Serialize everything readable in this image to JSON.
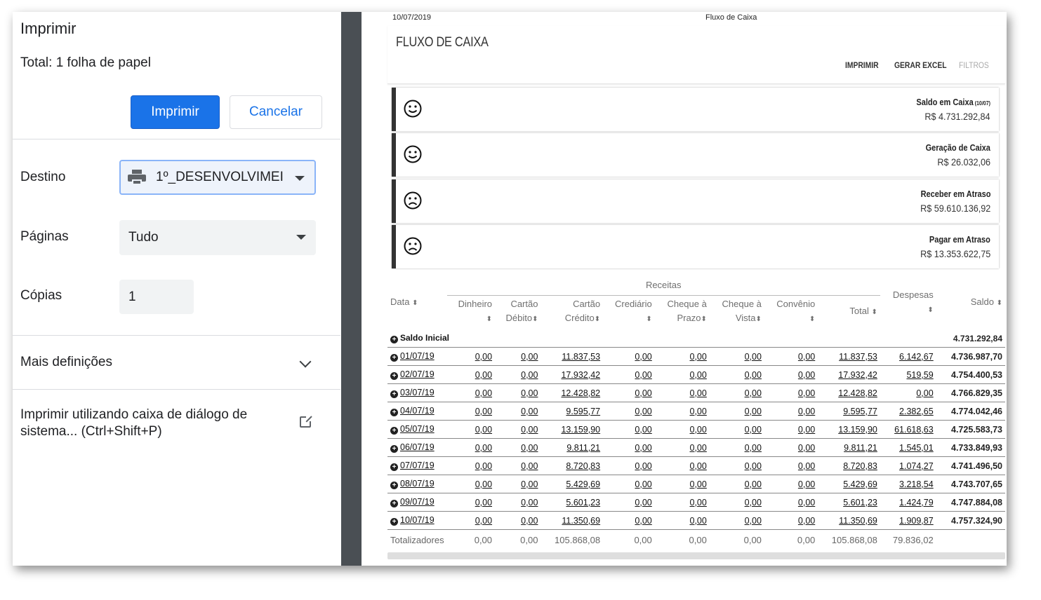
{
  "print_dialog": {
    "title": "Imprimir",
    "total": "Total: 1 folha de papel",
    "print_button": "Imprimir",
    "cancel_button": "Cancelar",
    "destination_label": "Destino",
    "destination_value": "1º_DESENVOLVIMEI",
    "pages_label": "Páginas",
    "pages_value": "Tudo",
    "copies_label": "Cópias",
    "copies_value": "1",
    "more_settings": "Mais definições",
    "system_dialog": "Imprimir utilizando caixa de diálogo de sistema... (Ctrl+Shift+P)"
  },
  "preview": {
    "header_date": "10/07/2019",
    "header_title": "Fluxo de Caixa",
    "page_title": "FLUXO DE CAIXA",
    "actions": [
      "IMPRIMIR",
      "GERAR EXCEL",
      "FILTROS"
    ],
    "kpis": [
      {
        "label": "Saldo em Caixa",
        "note": "(10/07)",
        "value": "R$ 4.731.292,84",
        "face": "happy"
      },
      {
        "label": "Geração de Caixa",
        "note": "",
        "value": "R$ 26.032,06",
        "face": "happy"
      },
      {
        "label": "Receber em Atraso",
        "note": "",
        "value": "R$ 59.610.136,92",
        "face": "sad"
      },
      {
        "label": "Pagar em Atraso",
        "note": "",
        "value": "R$ 13.353.622,75",
        "face": "sad"
      }
    ],
    "table": {
      "group_receitas": "Receitas",
      "headers": {
        "data": "Data",
        "dinheiro": "Dinheiro",
        "cartao_debito": [
          "Cartão",
          "Débito"
        ],
        "cartao_credito": [
          "Cartão",
          "Crédito"
        ],
        "crediario": "Crediário",
        "cheque_prazo": [
          "Cheque à",
          "Prazo"
        ],
        "cheque_vista": [
          "Cheque à",
          "Vista"
        ],
        "convenio": "Convênio",
        "total": "Total",
        "despesas": "Despesas",
        "saldo": "Saldo"
      },
      "saldo_inicial": {
        "label": "Saldo Inicial",
        "value": "4.731.292,84"
      },
      "rows": [
        [
          "01/07/19",
          "0,00",
          "0,00",
          "11.837,53",
          "0,00",
          "0,00",
          "0,00",
          "0,00",
          "11.837,53",
          "6.142,67",
          "4.736.987,70"
        ],
        [
          "02/07/19",
          "0,00",
          "0,00",
          "17.932,42",
          "0,00",
          "0,00",
          "0,00",
          "0,00",
          "17.932,42",
          "519,59",
          "4.754.400,53"
        ],
        [
          "03/07/19",
          "0,00",
          "0,00",
          "12.428,82",
          "0,00",
          "0,00",
          "0,00",
          "0,00",
          "12.428,82",
          "0,00",
          "4.766.829,35"
        ],
        [
          "04/07/19",
          "0,00",
          "0,00",
          "9.595,77",
          "0,00",
          "0,00",
          "0,00",
          "0,00",
          "9.595,77",
          "2.382,65",
          "4.774.042,46"
        ],
        [
          "05/07/19",
          "0,00",
          "0,00",
          "13.159,90",
          "0,00",
          "0,00",
          "0,00",
          "0,00",
          "13.159,90",
          "61.618,63",
          "4.725.583,73"
        ],
        [
          "06/07/19",
          "0,00",
          "0,00",
          "9.811,21",
          "0,00",
          "0,00",
          "0,00",
          "0,00",
          "9.811,21",
          "1.545,01",
          "4.733.849,93"
        ],
        [
          "07/07/19",
          "0,00",
          "0,00",
          "8.720,83",
          "0,00",
          "0,00",
          "0,00",
          "0,00",
          "8.720,83",
          "1.074,27",
          "4.741.496,50"
        ],
        [
          "08/07/19",
          "0,00",
          "0,00",
          "5.429,69",
          "0,00",
          "0,00",
          "0,00",
          "0,00",
          "5.429,69",
          "3.218,54",
          "4.743.707,65"
        ],
        [
          "09/07/19",
          "0,00",
          "0,00",
          "5.601,23",
          "0,00",
          "0,00",
          "0,00",
          "0,00",
          "5.601,23",
          "1.424,79",
          "4.747.884,08"
        ],
        [
          "10/07/19",
          "0,00",
          "0,00",
          "11.350,69",
          "0,00",
          "0,00",
          "0,00",
          "0,00",
          "11.350,69",
          "1.909,87",
          "4.757.324,90"
        ]
      ],
      "totals": [
        "Totalizadores",
        "0,00",
        "0,00",
        "105.868,08",
        "0,00",
        "0,00",
        "0,00",
        "0,00",
        "105.868,08",
        "79.836,02",
        ""
      ]
    }
  }
}
